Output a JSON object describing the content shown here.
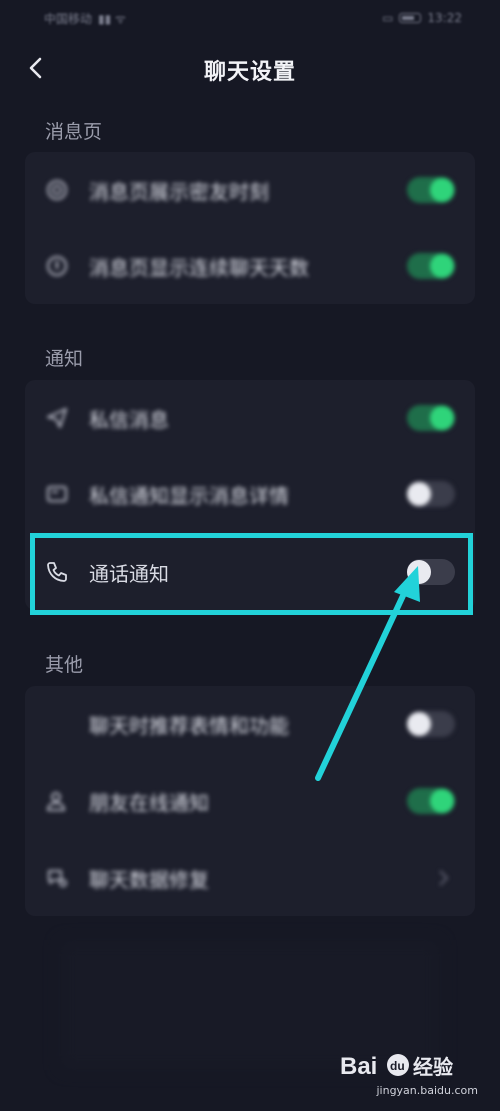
{
  "status_bar": {
    "carrier": "中国移动",
    "time": "13:22"
  },
  "header": {
    "title": "聊天设置"
  },
  "sections": [
    {
      "label": "消息页",
      "items": [
        {
          "label": "消息页展示密友时刻",
          "icon": "moment-icon",
          "control": "toggle",
          "on": true
        },
        {
          "label": "消息页显示连续聊天天数",
          "icon": "streak-icon",
          "control": "toggle",
          "on": true
        }
      ]
    },
    {
      "label": "通知",
      "items": [
        {
          "label": "私信消息",
          "icon": "send-icon",
          "control": "toggle",
          "on": true
        },
        {
          "label": "私信通知显示消息详情",
          "icon": "message-detail-icon",
          "control": "toggle",
          "on": false
        },
        {
          "label": "通话通知",
          "icon": "phone-icon",
          "control": "toggle",
          "on": false
        }
      ]
    },
    {
      "label": "其他",
      "items": [
        {
          "label": "聊天时推荐表情和功能",
          "icon": "",
          "control": "toggle",
          "on": false
        },
        {
          "label": "朋友在线通知",
          "icon": "user-online-icon",
          "control": "toggle",
          "on": true
        },
        {
          "label": "聊天数据修复",
          "icon": "chat-repair-icon",
          "control": "chevron"
        }
      ]
    }
  ],
  "colors": {
    "background": "#161824",
    "card": "#1d1f2c",
    "toggle_on": "#2fd47a",
    "highlight": "#22d2d9"
  },
  "watermark": {
    "brand": "Bai du 经验",
    "url": "jingyan.baidu.com"
  }
}
